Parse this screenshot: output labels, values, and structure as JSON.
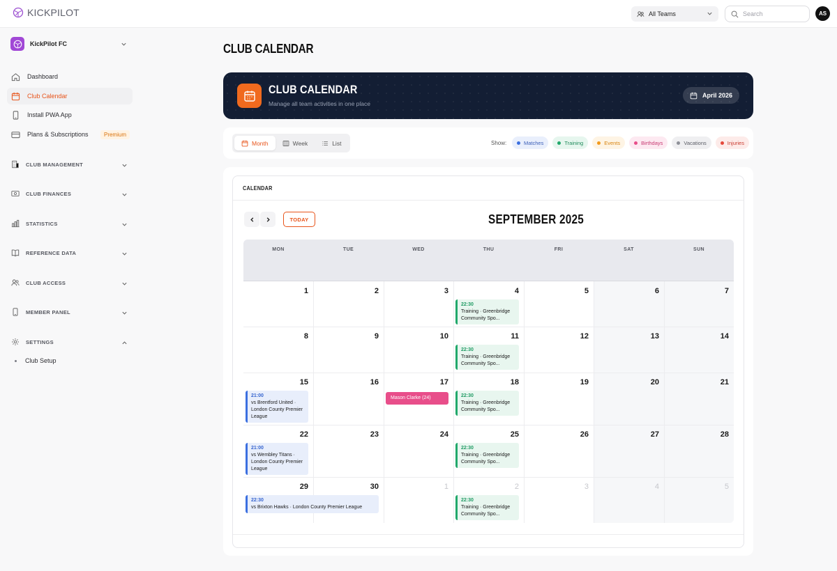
{
  "app": {
    "name": "KICKPILOT"
  },
  "topbar": {
    "team_select": "All Teams",
    "search_placeholder": "Search",
    "avatar_initials": "AS"
  },
  "sidebar": {
    "club_name": "KickPilot FC",
    "items": [
      {
        "label": "Dashboard",
        "icon": "home-icon"
      },
      {
        "label": "Club Calendar",
        "icon": "calendar-icon",
        "active": true
      },
      {
        "label": "Install PWA App",
        "icon": "phone-icon"
      },
      {
        "label": "Plans & Subscriptions",
        "icon": "card-icon",
        "badge": "Premium"
      }
    ],
    "sections": [
      {
        "label": "CLUB MANAGEMENT",
        "icon": "building-icon",
        "expanded": false
      },
      {
        "label": "CLUB FINANCES",
        "icon": "money-icon",
        "expanded": false
      },
      {
        "label": "STATISTICS",
        "icon": "bar-chart-icon",
        "expanded": false
      },
      {
        "label": "REFERENCE DATA",
        "icon": "book-icon",
        "expanded": false
      },
      {
        "label": "CLUB ACCESS",
        "icon": "users-icon",
        "expanded": false
      },
      {
        "label": "MEMBER PANEL",
        "icon": "phone-icon",
        "expanded": false
      },
      {
        "label": "SETTINGS",
        "icon": "gear-icon",
        "expanded": true
      }
    ],
    "settings_subitems": [
      "Club Setup"
    ]
  },
  "page": {
    "title": "CLUB CALENDAR"
  },
  "hero": {
    "title": "CLUB CALENDAR",
    "subtitle": "Manage all team activities in one place",
    "date": "April 2026"
  },
  "filters": {
    "views": [
      "Month",
      "Week",
      "List"
    ],
    "active_view": "Month",
    "show_label": "Show:",
    "chips": [
      {
        "label": "Matches",
        "color": "#3b6fe0",
        "bg": "#e9effc",
        "text": "#3b5fb8"
      },
      {
        "label": "Training",
        "color": "#21a86b",
        "bg": "#e6f6ee",
        "text": "#1f8a5a"
      },
      {
        "label": "Events",
        "color": "#f29a1c",
        "bg": "#fef4e4",
        "text": "#d98512"
      },
      {
        "label": "Birthdays",
        "color": "#e84e8a",
        "bg": "#fde9f1",
        "text": "#c73a72"
      },
      {
        "label": "Vacations",
        "color": "#8e9098",
        "bg": "#efeff1",
        "text": "#5b5d66"
      },
      {
        "label": "Injuries",
        "color": "#e5483b",
        "bg": "#fdebe9",
        "text": "#c93b2f"
      }
    ]
  },
  "calendar": {
    "card_title": "CALENDAR",
    "today_label": "TODAY",
    "month_title": "SEPTEMBER 2025",
    "weekdays": [
      "MON",
      "TUE",
      "WED",
      "THU",
      "FRI",
      "SAT",
      "SUN"
    ],
    "weeks": [
      [
        "1",
        "2",
        "3",
        "4",
        "5",
        "6",
        "7"
      ],
      [
        "8",
        "9",
        "10",
        "11",
        "12",
        "13",
        "14"
      ],
      [
        "15",
        "16",
        "17",
        "18",
        "19",
        "20",
        "21"
      ],
      [
        "22",
        "23",
        "24",
        "25",
        "26",
        "27",
        "28"
      ],
      [
        "29",
        "30",
        "1",
        "2",
        "3",
        "4",
        "5"
      ]
    ],
    "events": [
      {
        "week": 0,
        "day": 3,
        "type": "train",
        "time": "22:30",
        "title": "Training · Greenbridge Community Spo..."
      },
      {
        "week": 1,
        "day": 3,
        "type": "train",
        "time": "22:30",
        "title": "Training · Greenbridge Community Spo..."
      },
      {
        "week": 2,
        "day": 0,
        "type": "match",
        "time": "21:00",
        "title": "vs Brentford United · London County Premier League"
      },
      {
        "week": 2,
        "day": 2,
        "type": "bday",
        "time": "",
        "title": "Mason Clarke (24)"
      },
      {
        "week": 2,
        "day": 3,
        "type": "train",
        "time": "22:30",
        "title": "Training · Greenbridge Community Spo..."
      },
      {
        "week": 3,
        "day": 0,
        "type": "match",
        "time": "21:00",
        "title": "vs Wembley Titans · London County Premier League"
      },
      {
        "week": 3,
        "day": 3,
        "type": "train",
        "time": "22:30",
        "title": "Training · Greenbridge Community Spo..."
      },
      {
        "week": 4,
        "day": 0,
        "type": "match",
        "time": "22:30",
        "title": "vs Brixton Hawks · London County Premier League",
        "span": 2
      },
      {
        "week": 4,
        "day": 3,
        "type": "train",
        "time": "22:30",
        "title": "Training · Greenbridge Community Spo..."
      }
    ]
  }
}
